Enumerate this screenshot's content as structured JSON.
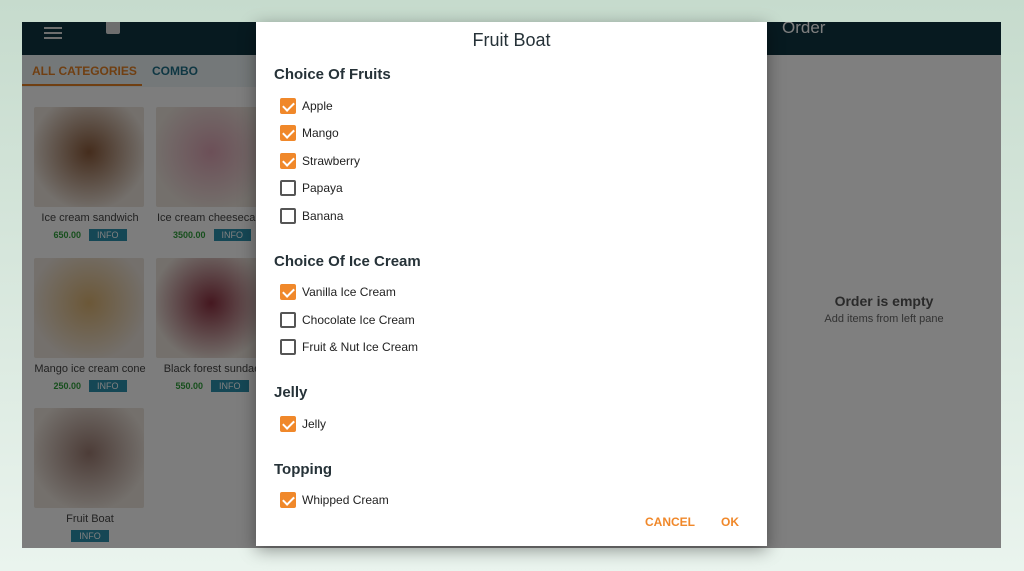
{
  "appbar": {
    "order_title": "Order"
  },
  "tabs": [
    {
      "label": "ALL CATEGORIES",
      "active": true
    },
    {
      "label": "COMBO",
      "active": false
    }
  ],
  "products": [
    {
      "name": "Ice cream sandwich",
      "price": "650.00",
      "info": "INFO",
      "color": "#8a5a3a"
    },
    {
      "name": "Ice cream cheesecake",
      "price": "3500.00",
      "info": "INFO",
      "color": "#d9a0b0"
    },
    {
      "name": "Mango ice cream cone",
      "price": "250.00",
      "info": "INFO",
      "color": "#d8b070"
    },
    {
      "name": "Black forest sundae",
      "price": "550.00",
      "info": "INFO",
      "color": "#8a3040"
    },
    {
      "name": "Fruit Boat",
      "price": "",
      "info": "INFO",
      "color": "#9a7a70"
    }
  ],
  "order": {
    "empty_title": "Order is empty",
    "empty_sub": "Add items from left pane"
  },
  "dialog": {
    "title": "Fruit Boat",
    "sections": [
      {
        "title": "Choice Of Fruits",
        "options": [
          {
            "label": "Apple",
            "checked": true
          },
          {
            "label": "Mango",
            "checked": true
          },
          {
            "label": "Strawberry",
            "checked": true
          },
          {
            "label": "Papaya",
            "checked": false
          },
          {
            "label": "Banana",
            "checked": false
          }
        ]
      },
      {
        "title": "Choice Of Ice Cream",
        "options": [
          {
            "label": "Vanilla Ice Cream",
            "checked": true
          },
          {
            "label": "Chocolate Ice Cream",
            "checked": false
          },
          {
            "label": "Fruit & Nut Ice Cream",
            "checked": false
          }
        ]
      },
      {
        "title": "Jelly",
        "options": [
          {
            "label": "Jelly",
            "checked": true
          }
        ]
      },
      {
        "title": "Topping",
        "options": [
          {
            "label": "Whipped Cream",
            "checked": true
          }
        ]
      }
    ],
    "cancel": "CANCEL",
    "ok": "OK"
  },
  "colors": {
    "accent": "#f0882a",
    "appbar": "#0f3440",
    "info": "#2a8fab",
    "price": "#2e9e3a"
  }
}
